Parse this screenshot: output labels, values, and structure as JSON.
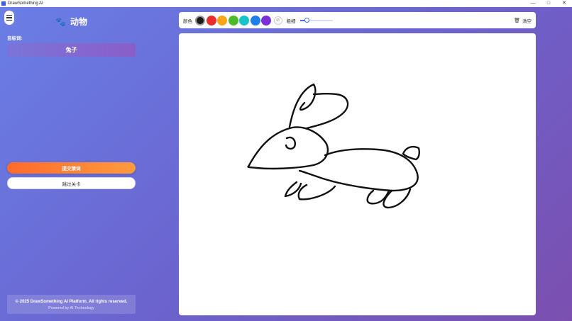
{
  "window": {
    "title": "DrawSomething AI",
    "minimize": "—",
    "maximize": "□",
    "close": "✕"
  },
  "sidebar": {
    "category": "动物",
    "category_icon": "paw-icon",
    "target_label": "目标词:",
    "target_word": "兔子",
    "submit_label": "提交猜词",
    "skip_label": "跳过关卡",
    "footer_copy": "© 2025 DrawSomething AI Platform. All rights reserved.",
    "footer_powered": "Powered by AI Technology"
  },
  "toolbar": {
    "color_label": "颜色",
    "colors": [
      "#1a1a1a",
      "#e82d2d",
      "#f9a51a",
      "#4cbb2a",
      "#17c3c8",
      "#1f7fe8",
      "#7b2fd4"
    ],
    "selected_color": "#1a1a1a",
    "eraser_icon": "eraser-icon",
    "size_label": "粗细",
    "size_value": 0.2,
    "clear_label": "清空"
  }
}
